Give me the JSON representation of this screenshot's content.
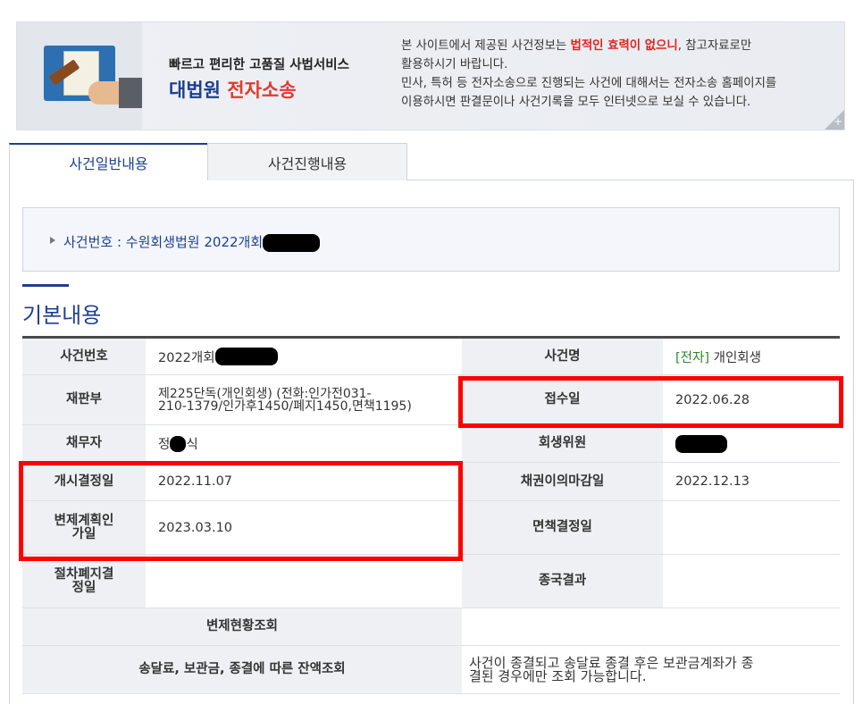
{
  "banner": {
    "slogan": "빠르고 편리한 고품질 사법서비스",
    "brand_part1": "대법원",
    "brand_part2": "전자소송",
    "notice_line1_a": "본 사이트에서 제공된 사건정보는 ",
    "notice_line1_red": "법적인 효력이 없으니",
    "notice_line1_b": ", 참고자료로만",
    "notice_line2": "활용하시기 바랍니다.",
    "notice_line3": "민사, 특허 등 전자소송으로 진행되는 사건에 대해서는 전자소송 홈페이지를",
    "notice_line4": "이용하시면 판결문이나 사건기록을 모두 인터넷으로 보실 수 있습니다.",
    "plus": "+"
  },
  "tabs": {
    "general": "사건일반내용",
    "progress": "사건진행내용"
  },
  "case_box": {
    "label": "사건번호 : 수원회생법원 2022개회"
  },
  "section_title": "기본내용",
  "table": {
    "case_no_label": "사건번호",
    "case_no_value": "2022개회",
    "case_name_label": "사건명",
    "case_name_tag": "[전자]",
    "case_name_value": " 개인회생",
    "division_label": "재판부",
    "division_line1": "제225단독(개인회생) (전화:인가전031-",
    "division_line2": "210-1379/인가후1450/폐지1450,면책1195)",
    "receipt_label": "접수일",
    "receipt_value": "2022.06.28",
    "debtor_label": "채무자",
    "debtor_value_a": "정",
    "debtor_value_b": "식",
    "commissioner_label": "회생위원",
    "start_label": "개시결정일",
    "start_value": "2022.11.07",
    "objection_label": "채권이의마감일",
    "objection_value": "2022.12.13",
    "plan_label_1": "변제계획인",
    "plan_label_2": "가일",
    "plan_value": "2023.03.10",
    "discharge_label": "면책결정일",
    "abolish_label_1": "절차폐지결",
    "abolish_label_2": "정일",
    "final_label": "종국결과",
    "repay_status_label": "변제현황조회",
    "balance_label": "송달료, 보관금, 종결에 따른 잔액조회",
    "balance_note_1": "사건이 종결되고 송달료 종결 후은 보관금계좌가 종",
    "balance_note_2": "결된 경우에만 조회 가능합니다."
  }
}
